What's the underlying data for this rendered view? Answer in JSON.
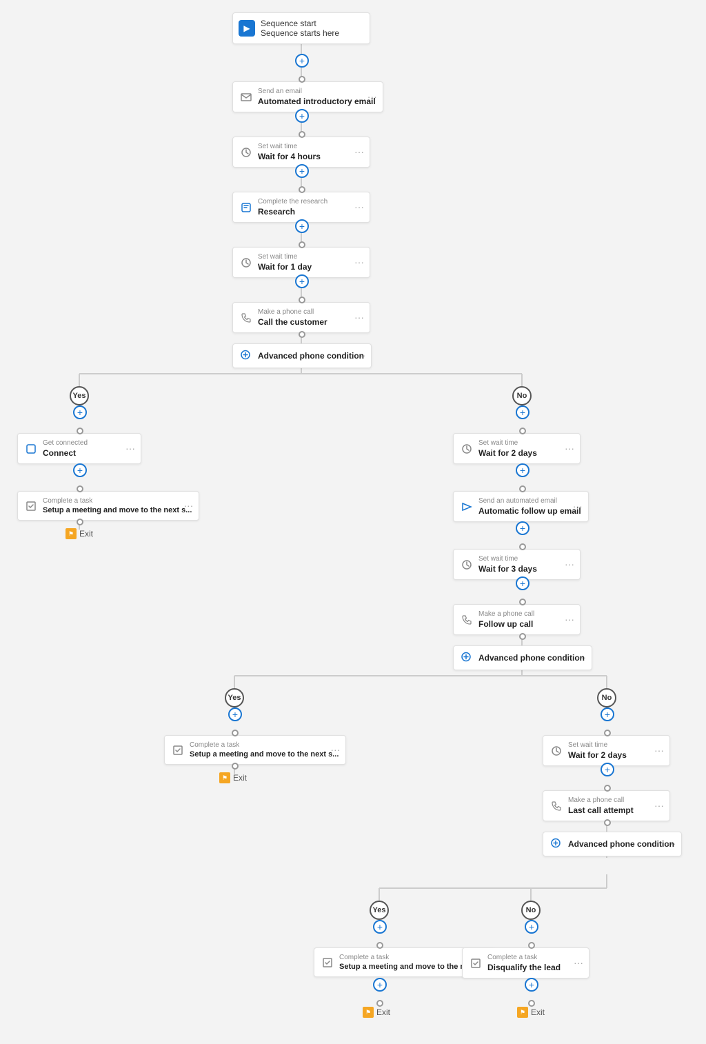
{
  "nodes": {
    "sequence_start": {
      "label": "Sequence start",
      "title": "Sequence starts here"
    },
    "send_email_1": {
      "label": "Send an email",
      "title": "Automated introductory email"
    },
    "wait_1": {
      "label": "Set wait time",
      "title": "Wait for 4 hours"
    },
    "research": {
      "label": "Complete the research",
      "title": "Research"
    },
    "wait_2": {
      "label": "Set wait time",
      "title": "Wait for 1 day"
    },
    "phone_call_1": {
      "label": "Make a phone call",
      "title": "Call the customer"
    },
    "condition_1": {
      "title": "Advanced phone condition"
    },
    "yes_label_1": "Yes",
    "no_label_1": "No",
    "connect": {
      "label": "Get connected",
      "title": "Connect"
    },
    "task_1": {
      "label": "Complete a task",
      "title": "Setup a meeting and move to the next s..."
    },
    "exit_1": "Exit",
    "wait_3": {
      "label": "Set wait time",
      "title": "Wait for 2 days"
    },
    "auto_email_2": {
      "label": "Send an automated email",
      "title": "Automatic follow up email"
    },
    "wait_4": {
      "label": "Set wait time",
      "title": "Wait for 3 days"
    },
    "phone_call_2": {
      "label": "Make a phone call",
      "title": "Follow up call"
    },
    "condition_2": {
      "title": "Advanced phone condition"
    },
    "yes_label_2": "Yes",
    "no_label_2": "No",
    "task_2": {
      "label": "Complete a task",
      "title": "Setup a meeting and move to the next s..."
    },
    "exit_2": "Exit",
    "wait_5": {
      "label": "Set wait time",
      "title": "Wait for 2 days"
    },
    "phone_call_3": {
      "label": "Make a phone call",
      "title": "Last call attempt"
    },
    "condition_3": {
      "title": "Advanced phone condition"
    },
    "yes_label_3": "Yes",
    "no_label_3": "No",
    "task_3": {
      "label": "Complete a task",
      "title": "Setup a meeting and move to the next s..."
    },
    "task_4": {
      "label": "Complete a task",
      "title": "Disqualify the lead"
    },
    "exit_3": "Exit",
    "exit_4": "Exit"
  },
  "icons": {
    "sequence": "▶",
    "email": "✉",
    "wait": "⏱",
    "research": "🔗",
    "phone": "📞",
    "condition": "🔀",
    "task": "☑",
    "exit": "⚑",
    "connect": "🔗",
    "auto_email": "▶",
    "dots": "⋯",
    "plus": "+"
  },
  "colors": {
    "blue": "#1976d2",
    "gray": "#888",
    "light_gray": "#e0e0e0",
    "orange": "#f5a623",
    "white": "#fff",
    "border": "#ccc",
    "connector": "#c0c0c0"
  }
}
